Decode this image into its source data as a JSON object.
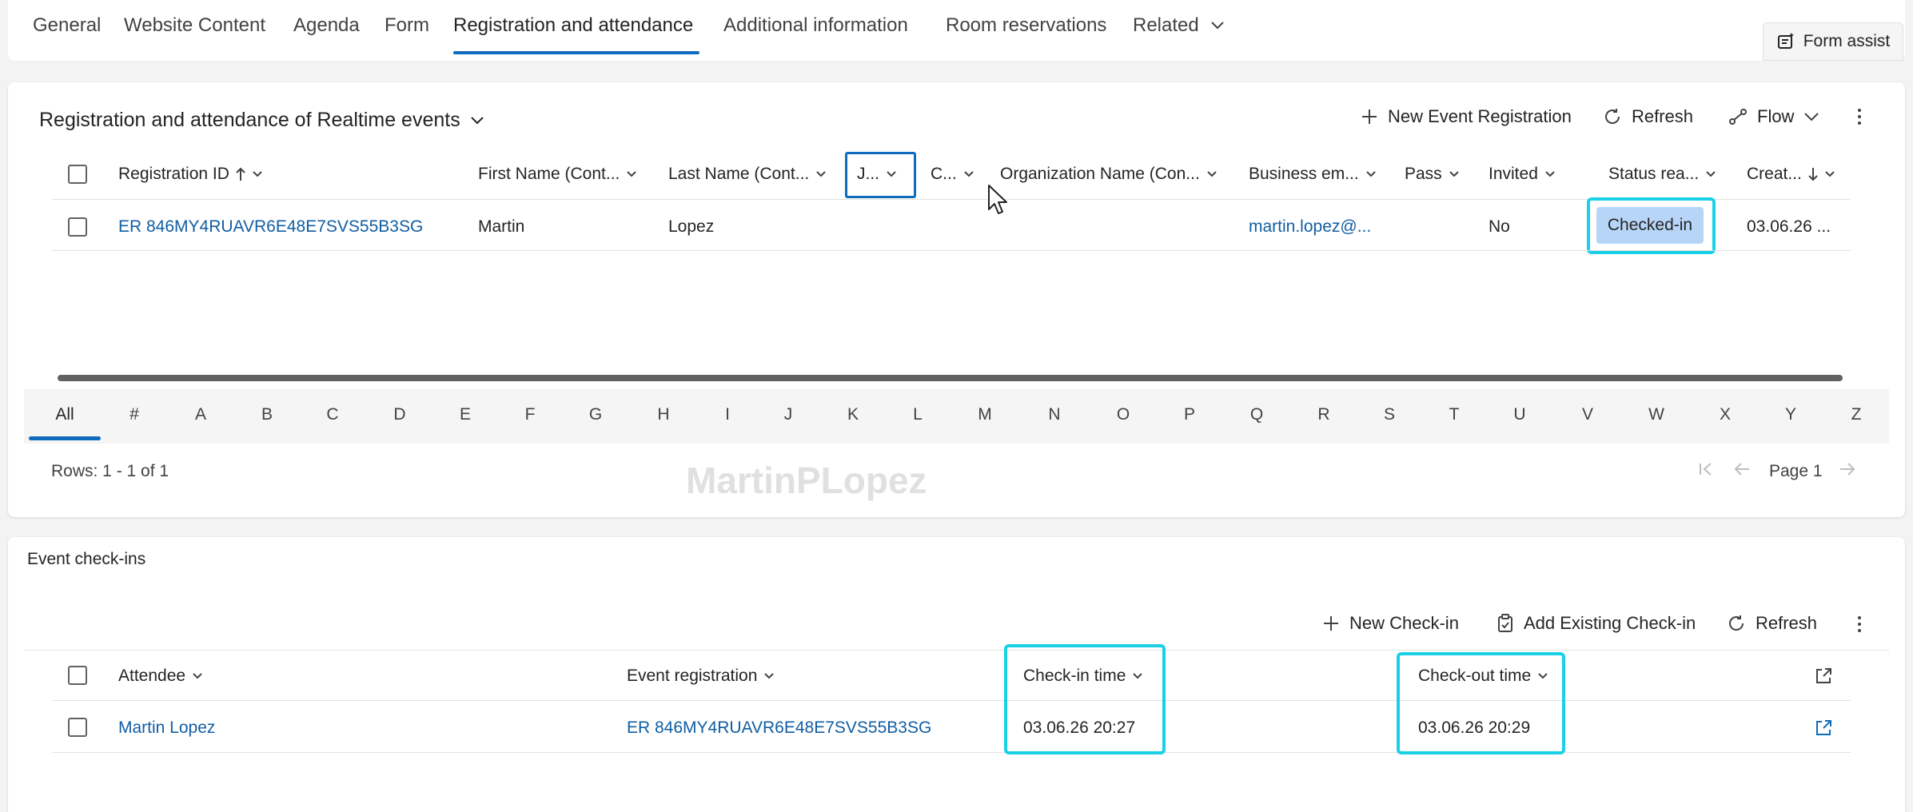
{
  "tabs": [
    {
      "label": "General"
    },
    {
      "label": "Website Content"
    },
    {
      "label": "Agenda"
    },
    {
      "label": "Form"
    },
    {
      "label": "Registration and attendance"
    },
    {
      "label": "Additional information"
    },
    {
      "label": "Room reservations"
    },
    {
      "label": "Related"
    }
  ],
  "form_assist": "Form assist",
  "registration": {
    "title": "Registration and attendance of Realtime events",
    "commands": {
      "new": "New Event Registration",
      "refresh": "Refresh",
      "flow": "Flow"
    },
    "columns": {
      "id": "Registration ID",
      "first": "First Name (Cont...",
      "last": "Last Name (Cont...",
      "j": "J...",
      "c": "C...",
      "org": "Organization Name (Con...",
      "email": "Business em...",
      "pass": "Pass",
      "invited": "Invited",
      "status": "Status rea...",
      "created": "Creat..."
    },
    "row": {
      "id": "ER 846MY4RUAVR6E48E7SVS55B3SG",
      "first": "Martin",
      "last": "Lopez",
      "email": "martin.lopez@...",
      "invited": "No",
      "status": "Checked-in",
      "created": "03.06.26 ..."
    },
    "alphabet": [
      "All",
      "#",
      "A",
      "B",
      "C",
      "D",
      "E",
      "F",
      "G",
      "H",
      "I",
      "J",
      "K",
      "L",
      "M",
      "N",
      "O",
      "P",
      "Q",
      "R",
      "S",
      "T",
      "U",
      "V",
      "W",
      "X",
      "Y",
      "Z"
    ],
    "rows_text": "Rows: 1 - 1 of 1",
    "page_text": "Page 1",
    "watermark": "MartinPLopez"
  },
  "checkins": {
    "title": "Event check-ins",
    "commands": {
      "new": "New Check-in",
      "add_existing": "Add Existing Check-in",
      "refresh": "Refresh"
    },
    "columns": {
      "attendee": "Attendee",
      "registration": "Event registration",
      "checkin": "Check-in time",
      "checkout": "Check-out time"
    },
    "row": {
      "attendee": "Martin Lopez",
      "registration": "ER 846MY4RUAVR6E48E7SVS55B3SG",
      "checkin": "03.06.26 20:27",
      "checkout": "03.06.26 20:29"
    }
  },
  "colors": {
    "accent": "#0f6cbd",
    "link": "#115ea3",
    "highlight": "#1ad0e6",
    "badge": "#b7d6f7"
  }
}
